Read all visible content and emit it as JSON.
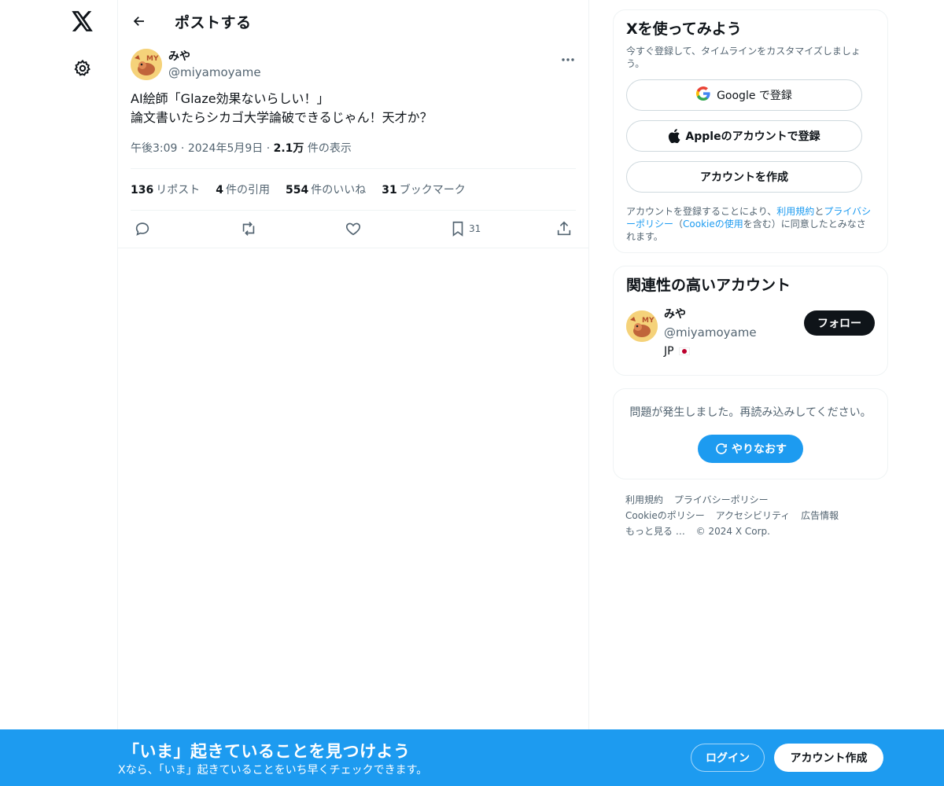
{
  "header": {
    "title": "ポストする"
  },
  "post": {
    "author_name": "みや",
    "author_handle": "@miyamoyame",
    "text_lines": [
      "AI絵師「Glaze効果ないらしい！」",
      "論文書いたらシカゴ大学論破できるじゃん！天才か？"
    ],
    "time": "午後3:09",
    "date": "2024年5月9日",
    "views_count": "2.1万",
    "views_label": "件の表示",
    "dot": "·",
    "stats": [
      {
        "count": "136",
        "label": "リポスト"
      },
      {
        "count": "4",
        "label": "件の引用"
      },
      {
        "count": "554",
        "label": "件のいいね"
      },
      {
        "count": "31",
        "label": "ブックマーク"
      }
    ],
    "bookmark_count": "31"
  },
  "signup_card": {
    "title": "Xを使ってみよう",
    "subtitle": "今すぐ登録して、タイムラインをカスタマイズしましょう。",
    "google_label": "Google で登録",
    "apple_label": "Appleのアカウントで登録",
    "create_label": "アカウントを作成",
    "legal_pre": "アカウントを登録することにより、",
    "legal_terms": "利用規約",
    "legal_and": "と",
    "legal_privacy": "プライバシーポリシー",
    "legal_paren_open": "（",
    "legal_cookie": "Cookieの使用",
    "legal_post": "を含む）に同意したとみなされます。"
  },
  "related": {
    "title": "関連性の高いアカウント",
    "name": "みや",
    "handle": "@miyamoyame",
    "location": "JP",
    "follow_label": "フォロー"
  },
  "error_card": {
    "message": "問題が発生しました。再読み込みしてください。",
    "retry_label": "やりなおす"
  },
  "footer": {
    "links": [
      "利用規約",
      "プライバシーポリシー",
      "Cookieのポリシー",
      "アクセシビリティ",
      "広告情報",
      "もっと見る …",
      "© 2024 X Corp."
    ]
  },
  "bottom_bar": {
    "title": "「いま」起きていることを見つけよう",
    "subtitle": "Xなら、「いま」起きていることをいち早くチェックできます。",
    "login_label": "ログイン",
    "signup_label": "アカウント作成"
  },
  "colors": {
    "accent": "#1d9bf0",
    "text": "#0f1419",
    "muted": "#536471",
    "border": "#eff3f4"
  },
  "icons": [
    "x-logo",
    "gear",
    "back-arrow",
    "more",
    "reply",
    "retweet",
    "like",
    "bookmark",
    "share",
    "google",
    "apple",
    "refresh"
  ]
}
